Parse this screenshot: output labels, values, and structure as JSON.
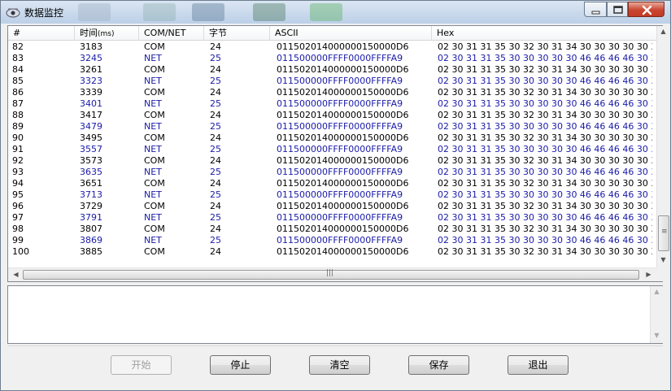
{
  "window": {
    "title": "数据监控"
  },
  "table": {
    "headers": {
      "num": "#",
      "time": "时间",
      "time_unit": "(ms)",
      "type": "COM/NET",
      "bytes": "字节",
      "ascii": "ASCII",
      "hex": "Hex"
    },
    "rows": [
      {
        "num": "82",
        "time": "3183",
        "type": "COM",
        "bytes": "24",
        "ascii": "011502014000000150000D6",
        "hex": "02 30 31 31 35 30 32 30 31 34 30 30 30 30 30 31 35 ..."
      },
      {
        "num": "83",
        "time": "3245",
        "type": "NET",
        "bytes": "25",
        "ascii": "011500000FFFF0000FFFFA9",
        "hex": "02 30 31 31 35 30 30 30 30 30 46 46 46 46 30 30 30 ..."
      },
      {
        "num": "84",
        "time": "3261",
        "type": "COM",
        "bytes": "24",
        "ascii": "011502014000000150000D6",
        "hex": "02 30 31 31 35 30 32 30 31 34 30 30 30 30 30 31 35 ..."
      },
      {
        "num": "85",
        "time": "3323",
        "type": "NET",
        "bytes": "25",
        "ascii": "011500000FFFF0000FFFFA9",
        "hex": "02 30 31 31 35 30 30 30 30 30 46 46 46 46 30 30 30 ..."
      },
      {
        "num": "86",
        "time": "3339",
        "type": "COM",
        "bytes": "24",
        "ascii": "011502014000000150000D6",
        "hex": "02 30 31 31 35 30 32 30 31 34 30 30 30 30 30 31 35 ..."
      },
      {
        "num": "87",
        "time": "3401",
        "type": "NET",
        "bytes": "25",
        "ascii": "011500000FFFF0000FFFFA9",
        "hex": "02 30 31 31 35 30 30 30 30 30 46 46 46 46 30 30 30 ..."
      },
      {
        "num": "88",
        "time": "3417",
        "type": "COM",
        "bytes": "24",
        "ascii": "011502014000000150000D6",
        "hex": "02 30 31 31 35 30 32 30 31 34 30 30 30 30 30 31 35 ..."
      },
      {
        "num": "89",
        "time": "3479",
        "type": "NET",
        "bytes": "25",
        "ascii": "011500000FFFF0000FFFFA9",
        "hex": "02 30 31 31 35 30 30 30 30 30 46 46 46 46 30 30 30 ..."
      },
      {
        "num": "90",
        "time": "3495",
        "type": "COM",
        "bytes": "24",
        "ascii": "011502014000000150000D6",
        "hex": "02 30 31 31 35 30 32 30 31 34 30 30 30 30 30 31 35 ..."
      },
      {
        "num": "91",
        "time": "3557",
        "type": "NET",
        "bytes": "25",
        "ascii": "011500000FFFF0000FFFFA9",
        "hex": "02 30 31 31 35 30 30 30 30 30 46 46 46 46 30 30 30 ..."
      },
      {
        "num": "92",
        "time": "3573",
        "type": "COM",
        "bytes": "24",
        "ascii": "011502014000000150000D6",
        "hex": "02 30 31 31 35 30 32 30 31 34 30 30 30 30 30 31 35 ..."
      },
      {
        "num": "93",
        "time": "3635",
        "type": "NET",
        "bytes": "25",
        "ascii": "011500000FFFF0000FFFFA9",
        "hex": "02 30 31 31 35 30 30 30 30 30 46 46 46 46 30 30 30 ..."
      },
      {
        "num": "94",
        "time": "3651",
        "type": "COM",
        "bytes": "24",
        "ascii": "011502014000000150000D6",
        "hex": "02 30 31 31 35 30 32 30 31 34 30 30 30 30 30 31 35 ..."
      },
      {
        "num": "95",
        "time": "3713",
        "type": "NET",
        "bytes": "25",
        "ascii": "011500000FFFF0000FFFFA9",
        "hex": "02 30 31 31 35 30 30 30 30 30 46 46 46 46 30 30 30 ..."
      },
      {
        "num": "96",
        "time": "3729",
        "type": "COM",
        "bytes": "24",
        "ascii": "011502014000000150000D6",
        "hex": "02 30 31 31 35 30 32 30 31 34 30 30 30 30 30 31 35 ..."
      },
      {
        "num": "97",
        "time": "3791",
        "type": "NET",
        "bytes": "25",
        "ascii": "011500000FFFF0000FFFFA9",
        "hex": "02 30 31 31 35 30 30 30 30 30 46 46 46 46 30 30 30 ..."
      },
      {
        "num": "98",
        "time": "3807",
        "type": "COM",
        "bytes": "24",
        "ascii": "011502014000000150000D6",
        "hex": "02 30 31 31 35 30 32 30 31 34 30 30 30 30 30 31 35 ..."
      },
      {
        "num": "99",
        "time": "3869",
        "type": "NET",
        "bytes": "25",
        "ascii": "011500000FFFF0000FFFFA9",
        "hex": "02 30 31 31 35 30 30 30 30 30 46 46 46 46 30 30 30 ..."
      },
      {
        "num": "100",
        "time": "3885",
        "type": "COM",
        "bytes": "24",
        "ascii": "011502014000000150000D6",
        "hex": "02 30 31 31 35 30 32 30 31 34 30 30 30 30 30 31 35 ..."
      }
    ]
  },
  "log": {
    "text": ""
  },
  "buttons": {
    "start": "开始",
    "stop": "停止",
    "clear": "清空",
    "save": "保存",
    "exit": "退出"
  },
  "colors": {
    "com_text": "#000000",
    "net_text": "#1a1aa8",
    "close_button": "#c9452f"
  },
  "icons": {
    "app": "monitor-eye-icon",
    "minimize": "minimize-icon",
    "maximize": "maximize-icon",
    "close": "close-icon"
  }
}
